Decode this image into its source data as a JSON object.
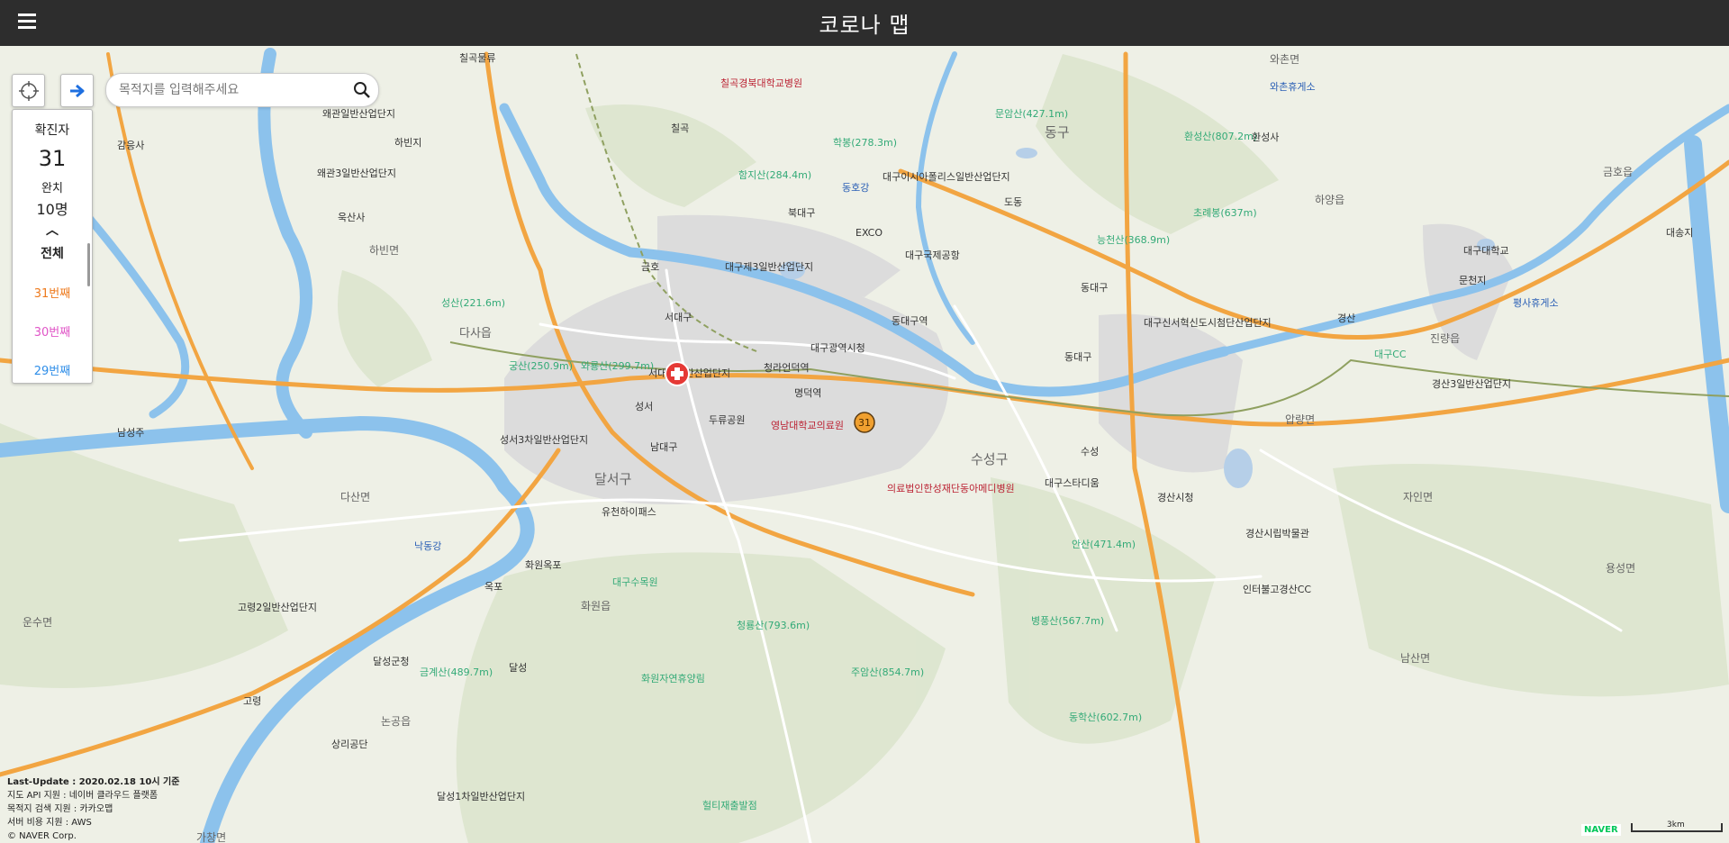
{
  "header": {
    "title": "코로나 맵"
  },
  "search": {
    "placeholder": "목적지를 입력해주세요"
  },
  "panel": {
    "confirmed_label": "확진자",
    "confirmed_count": "31",
    "recovered_label": "완치",
    "recovered_count": "10명",
    "all_label": "전체",
    "cases": [
      {
        "label": "31번째",
        "color": "#ee7a1d"
      },
      {
        "label": "30번째",
        "color": "#e056c7"
      },
      {
        "label": "29번째",
        "color": "#2f8ee8"
      }
    ]
  },
  "map": {
    "labels": [
      {
        "text": "칠곡물류"
      },
      {
        "text": "왜관일반산업단지"
      },
      {
        "text": "감응사"
      },
      {
        "text": "하빈지"
      },
      {
        "text": "왜관3일반산업단지"
      },
      {
        "text": "욱산사"
      },
      {
        "text": "하빈면"
      },
      {
        "text": "칠곡경북대학교병원"
      },
      {
        "text": "칠곡"
      },
      {
        "text": "학봉(278.3m)"
      },
      {
        "text": "함지산(284.4m)"
      },
      {
        "text": "문암산(427.1m)"
      },
      {
        "text": "동구"
      },
      {
        "text": "환성산(807.2m)"
      },
      {
        "text": "환성사"
      },
      {
        "text": "와촌면"
      },
      {
        "text": "와촌휴게소"
      },
      {
        "text": "금호읍"
      },
      {
        "text": "대구이시아폴리스일반산업단지"
      },
      {
        "text": "북대구"
      },
      {
        "text": "동호강"
      },
      {
        "text": "EXCO"
      },
      {
        "text": "도동"
      },
      {
        "text": "초례봉(637m)"
      },
      {
        "text": "하양읍"
      },
      {
        "text": "대구대학교"
      },
      {
        "text": "대송지"
      },
      {
        "text": "능천산(368.9m)"
      },
      {
        "text": "대구국제공항"
      },
      {
        "text": "금호"
      },
      {
        "text": "대구제3일반산업단지"
      },
      {
        "text": "성산(221.6m)"
      },
      {
        "text": "동대구"
      },
      {
        "text": "문천지"
      },
      {
        "text": "평사휴게소"
      },
      {
        "text": "다사읍"
      },
      {
        "text": "서대구"
      },
      {
        "text": "동대구역"
      },
      {
        "text": "대구신서혁신도시첨단산업단지"
      },
      {
        "text": "경산"
      },
      {
        "text": "궁산(250.9m)"
      },
      {
        "text": "와룡산(299.7m)"
      },
      {
        "text": "서대구일반산업단지"
      },
      {
        "text": "대구광역시청"
      },
      {
        "text": "청라언덕역"
      },
      {
        "text": "대구CC"
      },
      {
        "text": "진량읍"
      },
      {
        "text": "경산3일반산업단지"
      },
      {
        "text": "성서"
      },
      {
        "text": "명덕역"
      },
      {
        "text": "동대구"
      },
      {
        "text": "압량면"
      },
      {
        "text": "남성주"
      },
      {
        "text": "두류공원"
      },
      {
        "text": "영남대학교의료원"
      },
      {
        "text": "성서3차일반산업단지"
      },
      {
        "text": "남대구"
      },
      {
        "text": "수성구"
      },
      {
        "text": "수성"
      },
      {
        "text": "달서구"
      },
      {
        "text": "의료법인한성재단동아메디병원"
      },
      {
        "text": "대구스타디움"
      },
      {
        "text": "경산시청"
      },
      {
        "text": "자인면"
      },
      {
        "text": "다산면"
      },
      {
        "text": "유천하이패스"
      },
      {
        "text": "낙동강"
      },
      {
        "text": "경산시립박물관"
      },
      {
        "text": "안산(471.4m)"
      },
      {
        "text": "화원옥포"
      },
      {
        "text": "옥포"
      },
      {
        "text": "대구수목원"
      },
      {
        "text": "인터불고경산CC"
      },
      {
        "text": "용성면"
      },
      {
        "text": "고령2일반산업단지"
      },
      {
        "text": "화원읍"
      },
      {
        "text": "청룡산(793.6m)"
      },
      {
        "text": "병풍산(567.7m)"
      },
      {
        "text": "운수면"
      },
      {
        "text": "달성군청"
      },
      {
        "text": "금계산(489.7m)"
      },
      {
        "text": "달성"
      },
      {
        "text": "화원자연휴양림"
      },
      {
        "text": "주암산(854.7m)"
      },
      {
        "text": "남산면"
      },
      {
        "text": "고령"
      },
      {
        "text": "논공읍"
      },
      {
        "text": "동학산(602.7m)"
      },
      {
        "text": "상리공단"
      },
      {
        "text": "달성1차일반산업단지"
      },
      {
        "text": "헐티재출발점"
      },
      {
        "text": "가창면"
      }
    ],
    "case_marker": "31"
  },
  "footer": {
    "update": "Last-Update : 2020.02.18 10시 기준",
    "map_api": "지도 API 지원 : 네이버 클라우드 플랫폼",
    "search_api": "목적지 검색 지원 : 카카오맵",
    "server": "서버 비용 지원 : AWS",
    "copyright": "© NAVER Corp."
  },
  "naver_logo": "NAVER",
  "scale_label": "3km",
  "colors": {
    "header_bg": "#2d2d2d",
    "land": "#eef0e6",
    "water": "#8cc2ec",
    "highway": "#f2a542",
    "road": "#ffffff"
  }
}
